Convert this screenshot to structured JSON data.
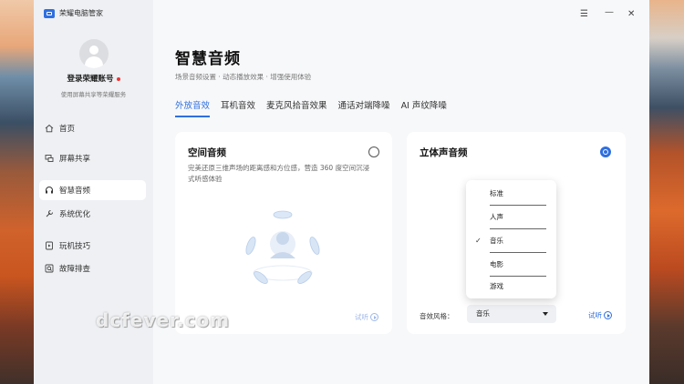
{
  "app": {
    "title": "荣耀电脑管家"
  },
  "account": {
    "login_label": "登录荣耀账号",
    "subtitle": "使用屏幕共享等荣耀服务"
  },
  "sidebar": {
    "items": [
      {
        "label": "首页",
        "icon": "home-icon"
      },
      {
        "label": "屏幕共享",
        "icon": "screen-share-icon"
      },
      {
        "label": "智慧音频",
        "icon": "headphone-icon",
        "active": true
      },
      {
        "label": "系统优化",
        "icon": "wrench-icon"
      },
      {
        "label": "玩机技巧",
        "icon": "tips-icon"
      },
      {
        "label": "故障排查",
        "icon": "troubleshoot-icon"
      }
    ]
  },
  "main": {
    "title": "智慧音频",
    "subtitle": "场景音频设置 · 动态播放效果 · 增强使用体验",
    "tabs": [
      {
        "label": "外放音效",
        "active": true
      },
      {
        "label": "耳机音效"
      },
      {
        "label": "麦克风拾音效果"
      },
      {
        "label": "通话对端降噪"
      },
      {
        "label": "AI 声纹降噪"
      }
    ]
  },
  "cards": {
    "spatial": {
      "title": "空间音频",
      "desc": "完美还原三维声场的距离感和方位感，营造 360 度空间沉浸式听感体验",
      "selected": false,
      "try_label": "试听"
    },
    "stereo": {
      "title": "立体声音频",
      "selected": true,
      "style_label": "音效风格：",
      "style_value": "音乐",
      "try_label": "试听"
    }
  },
  "dropdown": {
    "options": [
      "标准",
      "人声",
      "音乐",
      "电影",
      "游戏"
    ],
    "selected": "音乐"
  },
  "watermark": "dcfever.com",
  "colors": {
    "accent": "#2f6fe0"
  }
}
